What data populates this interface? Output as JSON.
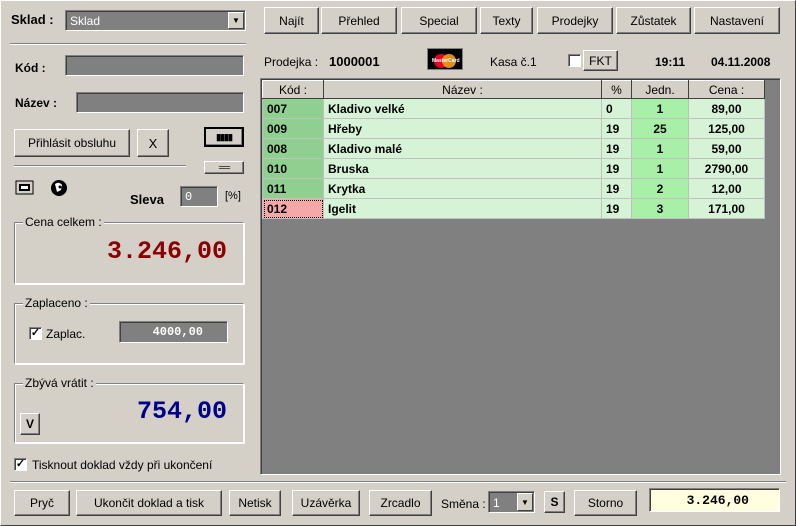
{
  "header": {
    "sklad_label": "Sklad :",
    "sklad_value": "Sklad",
    "tabs": [
      "Najít",
      "Přehled",
      "Special",
      "Texty",
      "Prodejky",
      "Zůstatek",
      "Nastavení"
    ]
  },
  "left": {
    "kod_label": "Kód :",
    "kod_value": "",
    "nazev_label": "Název :",
    "nazev_value": "",
    "login_button": "Přihlásit obsluhu",
    "x_button": "X",
    "grid_icon_top": "▮▮▮▮",
    "grid_icon_bottom": "===",
    "sleva_label": "Sleva",
    "sleva_value": "0",
    "sleva_unit": "[%]",
    "cena_group": "Cena celkem :",
    "cena_value": "3.246,00",
    "zaplaceno_group": "Zaplaceno :",
    "zaplac_label": "Zaplac.",
    "zaplac_checked": true,
    "zaplac_value": "4000,00",
    "zbyva_group": "Zbývá vrátit :",
    "zbyva_button": "V",
    "zbyva_value": "754,00",
    "tisk_label": "Tisknout doklad vždy při ukončení",
    "tisk_checked": true
  },
  "info": {
    "prodejka_label": "Prodejka :",
    "prodejka_value": "1000001",
    "card_text": "MasterCard",
    "kasa_label": "Kasa č.1",
    "fkt_button": "FKT",
    "time": "19:11",
    "date": "04.11.2008"
  },
  "table": {
    "headers": [
      "Kód :",
      "Název :",
      "%",
      "Jedn.",
      "Cena :"
    ],
    "rows": [
      {
        "kod": "007",
        "nazev": "Kladivo velké",
        "pct": "0",
        "jedn": "1",
        "cena": "89,00"
      },
      {
        "kod": "009",
        "nazev": "Hřeby",
        "pct": "19",
        "jedn": "25",
        "cena": "125,00"
      },
      {
        "kod": "008",
        "nazev": "Kladivo malé",
        "pct": "19",
        "jedn": "1",
        "cena": "59,00"
      },
      {
        "kod": "010",
        "nazev": "Bruska",
        "pct": "19",
        "jedn": "1",
        "cena": "2790,00"
      },
      {
        "kod": "011",
        "nazev": "Krytka",
        "pct": "19",
        "jedn": "2",
        "cena": "12,00"
      },
      {
        "kod": "012",
        "nazev": "Igelit",
        "pct": "19",
        "jedn": "3",
        "cena": "171,00"
      }
    ]
  },
  "footer": {
    "pryc": "Pryč",
    "ukoncit": "Ukončit doklad a tisk",
    "netisk": "Netisk",
    "uzaverka": "Uzávěrka",
    "zrcadlo": "Zrcadlo",
    "smena_label": "Směna :",
    "smena_value": "1",
    "s_button": "S",
    "storno": "Storno",
    "total": "3.246,00"
  },
  "colors": {
    "cena": "#8b0000",
    "zbyva": "#00008b",
    "row_bg": "#d7f3d7",
    "kod_bg": "#8fcf8f",
    "jedn_bg": "#a8f0a8",
    "selected_kod_bg": "#f4a8a8",
    "total_bg": "#ffffe0"
  }
}
